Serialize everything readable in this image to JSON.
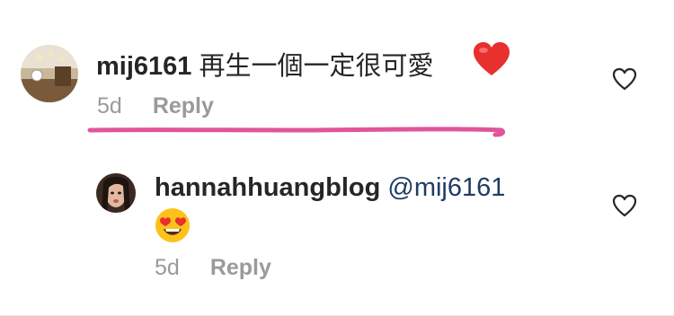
{
  "comments": [
    {
      "username": "mij6161",
      "text": "再生一個一定很可愛",
      "emoji": "red-heart",
      "time": "5d",
      "reply_label": "Reply"
    },
    {
      "username": "hannahhuangblog",
      "mention": "@mij6161",
      "emoji": "heart-eyes",
      "time": "5d",
      "reply_label": "Reply"
    }
  ],
  "colors": {
    "highlight_underline": "#e0559a",
    "mention": "#1f3c63",
    "meta": "#9a9a9a"
  },
  "icons": [
    "like-heart-outline-icon",
    "red-heart-emoji",
    "heart-eyes-emoji"
  ]
}
